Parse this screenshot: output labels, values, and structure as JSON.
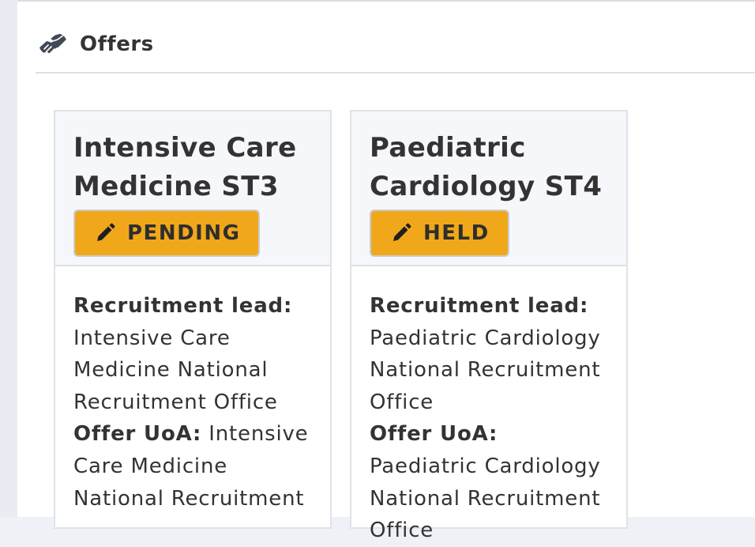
{
  "panel": {
    "title": "Offers",
    "icon": "handshake-icon"
  },
  "offers": [
    {
      "title_line1": "Intensive Care",
      "title_line2": "Medicine ST3",
      "status": "PENDING",
      "status_icon": "pencil-icon",
      "recruitment_lead_label": "Recruitment lead:",
      "recruitment_lead_value": "Intensive Care Medicine National Recruitment Office",
      "offer_uoa_label": "Offer UoA:",
      "offer_uoa_value": "Intensive Care Medicine National Recruitment"
    },
    {
      "title_line1": "Paediatric",
      "title_line2": "Cardiology ST4",
      "status": "HELD",
      "status_icon": "pencil-icon",
      "recruitment_lead_label": "Recruitment lead:",
      "recruitment_lead_value": "Paediatric Cardiology National Recruitment Office",
      "offer_uoa_label": "Offer UoA:",
      "offer_uoa_value": "Paediatric Cardiology National Recruitment Office"
    }
  ],
  "colors": {
    "status_button": "#f0a81a",
    "card_header_bg": "#f6f7fb",
    "text": "#333333"
  }
}
